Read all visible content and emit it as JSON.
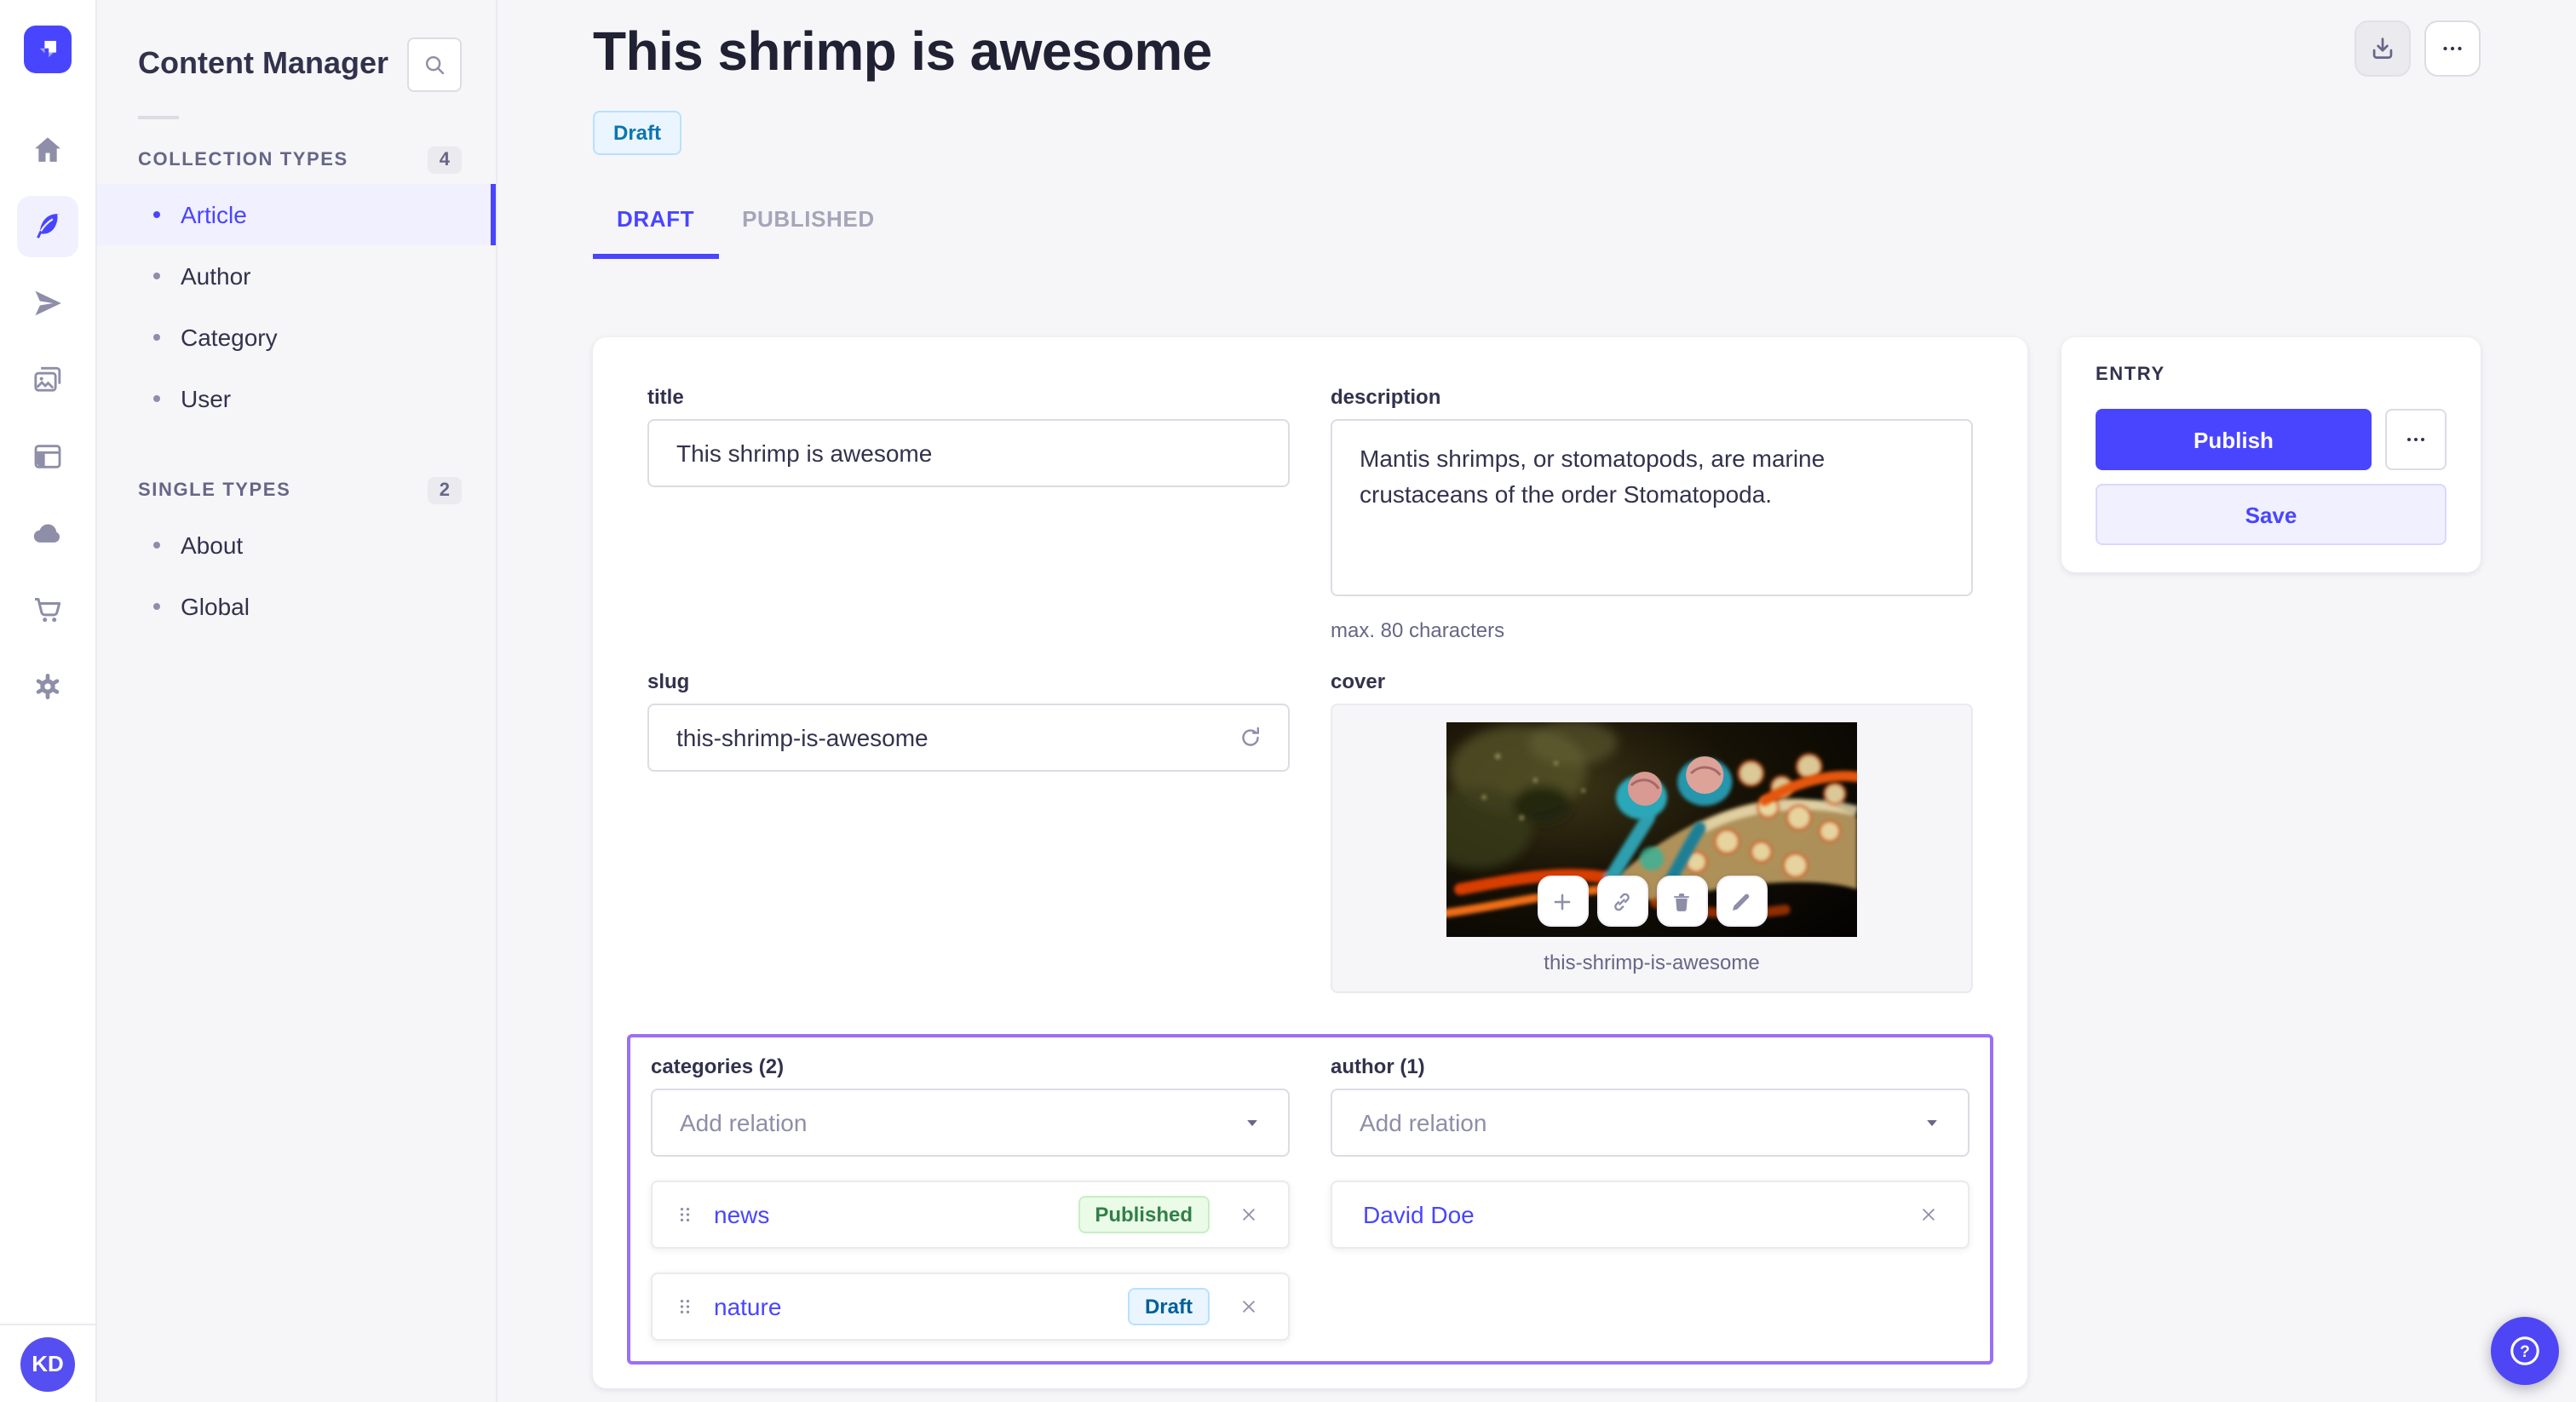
{
  "app": {
    "brand_color": "#4945ff",
    "highlight_border_color": "#9b6ff3",
    "background_color": "#f6f6f9"
  },
  "rail": {
    "logo_icon": "strapi-logo",
    "items": [
      {
        "icon": "home-icon",
        "active": false
      },
      {
        "icon": "content-manager-icon",
        "active": true
      },
      {
        "icon": "releases-icon",
        "active": false
      },
      {
        "icon": "media-library-icon",
        "active": false
      },
      {
        "icon": "content-type-builder-icon",
        "active": false
      },
      {
        "icon": "deploy-icon",
        "active": false
      },
      {
        "icon": "marketplace-icon",
        "active": false
      },
      {
        "icon": "settings-icon",
        "active": false
      }
    ],
    "avatar_initials": "KD"
  },
  "nav": {
    "title": "Content Manager",
    "search_icon": "search-icon",
    "sections": [
      {
        "label": "COLLECTION TYPES",
        "count": "4",
        "items": [
          {
            "label": "Article",
            "active": true
          },
          {
            "label": "Author",
            "active": false
          },
          {
            "label": "Category",
            "active": false
          },
          {
            "label": "User",
            "active": false
          }
        ]
      },
      {
        "label": "SINGLE TYPES",
        "count": "2",
        "items": [
          {
            "label": "About",
            "active": false
          },
          {
            "label": "Global",
            "active": false
          }
        ]
      }
    ]
  },
  "header": {
    "title": "This shrimp is awesome",
    "status_badge": "Draft",
    "download_icon": "download-icon",
    "more_icon": "more-horizontal-icon",
    "tabs": [
      {
        "label": "DRAFT",
        "active": true
      },
      {
        "label": "PUBLISHED",
        "active": false
      }
    ]
  },
  "form": {
    "title": {
      "label": "title",
      "value": "This shrimp is awesome"
    },
    "description": {
      "label": "description",
      "value": "Mantis shrimps, or stomatopods, are marine crustaceans of the order Stomatopoda.",
      "hint": "max. 80 characters"
    },
    "slug": {
      "label": "slug",
      "value": "this-shrimp-is-awesome",
      "refresh_icon": "regenerate-icon"
    },
    "cover": {
      "label": "cover",
      "caption": "this-shrimp-is-awesome",
      "action_icons": [
        "plus-icon",
        "link-icon",
        "trash-icon",
        "pencil-icon"
      ]
    },
    "categories": {
      "label": "categories (2)",
      "placeholder": "Add relation",
      "items": [
        {
          "name": "news",
          "status": "Published"
        },
        {
          "name": "nature",
          "status": "Draft"
        }
      ]
    },
    "author": {
      "label": "author (1)",
      "placeholder": "Add relation",
      "items": [
        {
          "name": "David Doe"
        }
      ]
    }
  },
  "entry": {
    "label": "ENTRY",
    "publish_label": "Publish",
    "save_label": "Save",
    "more_icon": "more-horizontal-icon"
  },
  "fab": {
    "icon": "help-icon",
    "glyph": "?"
  },
  "status_colors": {
    "published": {
      "bg": "#eafbe7",
      "border": "#c6f0c2",
      "text": "#328048"
    },
    "draft": {
      "bg": "#eaf5ff",
      "border": "#b8e1ff",
      "text": "#006096"
    }
  }
}
